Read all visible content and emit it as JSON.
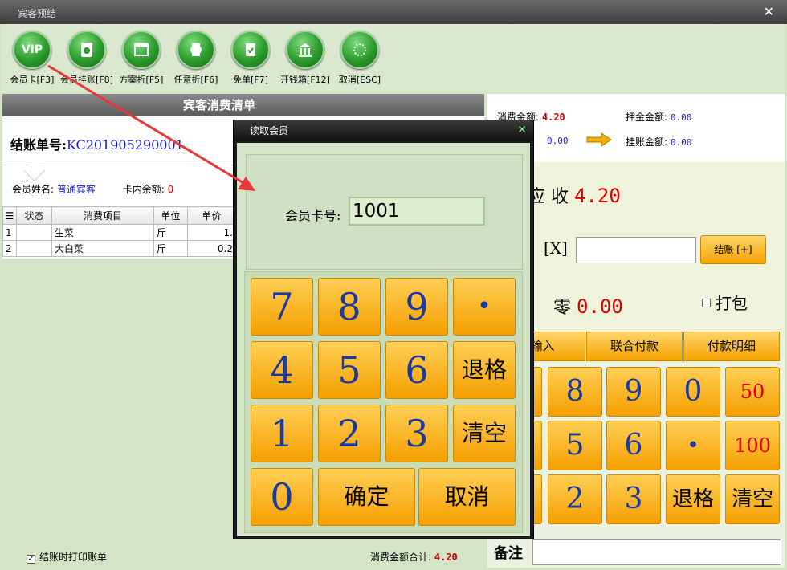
{
  "window": {
    "title": "宾客预结",
    "close": "✕"
  },
  "toolbar": [
    {
      "name": "member-card",
      "label": "会员卡[F3]",
      "glyph": "VIP"
    },
    {
      "name": "member-credit",
      "label": "会员挂账[F8]",
      "glyph": ""
    },
    {
      "name": "plan-discount",
      "label": "方案折[F5]",
      "glyph": ""
    },
    {
      "name": "any-discount",
      "label": "任意折[F6]",
      "glyph": ""
    },
    {
      "name": "free-order",
      "label": "免单[F7]",
      "glyph": ""
    },
    {
      "name": "cash-drawer",
      "label": "开钱箱[F12]",
      "glyph": ""
    },
    {
      "name": "cancel",
      "label": "取消[ESC]",
      "glyph": ""
    }
  ],
  "left": {
    "header": "宾客消费清单",
    "bill_label": "结账单号:",
    "bill_no": "KC201905290001",
    "member_name_label": "会员姓名:",
    "member_name": "普通宾客",
    "card_balance_label": "卡内余额:",
    "card_balance": "0",
    "table_headers": [
      "",
      "状态",
      "消费项目",
      "单位",
      "单价"
    ],
    "rows": [
      {
        "idx": "1",
        "status": "",
        "item": "生菜",
        "unit": "斤",
        "price": "1."
      },
      {
        "idx": "2",
        "status": "",
        "item": "大白菜",
        "unit": "斤",
        "price": "0.2"
      }
    ],
    "print_checkbox_label": "结账时打印账单",
    "print_checked": true,
    "total_label": "消费金额合计:",
    "total_value": "4.20"
  },
  "right": {
    "consume_label": "消费金额:",
    "consume_value": "4.20",
    "deposit_label": "押金金额:",
    "deposit_value": "0.00",
    "left_value": "0.00",
    "credit_label": "挂账金额:",
    "credit_value": "0.00",
    "due_label": "应 收",
    "due_value": "4.20",
    "x_label": "[X]",
    "pay_button": "结账 [+]",
    "change_label": "零",
    "change_value": "0.00",
    "pack_label": "打包",
    "tabs": [
      "金输入",
      "联合付款",
      "付款明细"
    ],
    "keys_row1": [
      "8",
      "9",
      "0",
      "50"
    ],
    "keys_row2": [
      "5",
      "6",
      "•",
      "100"
    ],
    "keys_row3": [
      "2",
      "3",
      "退格",
      "清空"
    ],
    "remark_label": "备注"
  },
  "dialog": {
    "title": "读取会员",
    "close": "✕",
    "card_label": "会员卡号:",
    "card_value": "1001",
    "keys": [
      "7",
      "8",
      "9",
      "•",
      "4",
      "5",
      "6",
      "退格",
      "1",
      "2",
      "3",
      "清空",
      "0",
      "确定",
      "取消"
    ]
  },
  "colors": {
    "accent_red": "#d00000",
    "link_blue": "#1a1ad0",
    "key_orange": "#f5a300",
    "bg_green": "#d3e4c7"
  }
}
